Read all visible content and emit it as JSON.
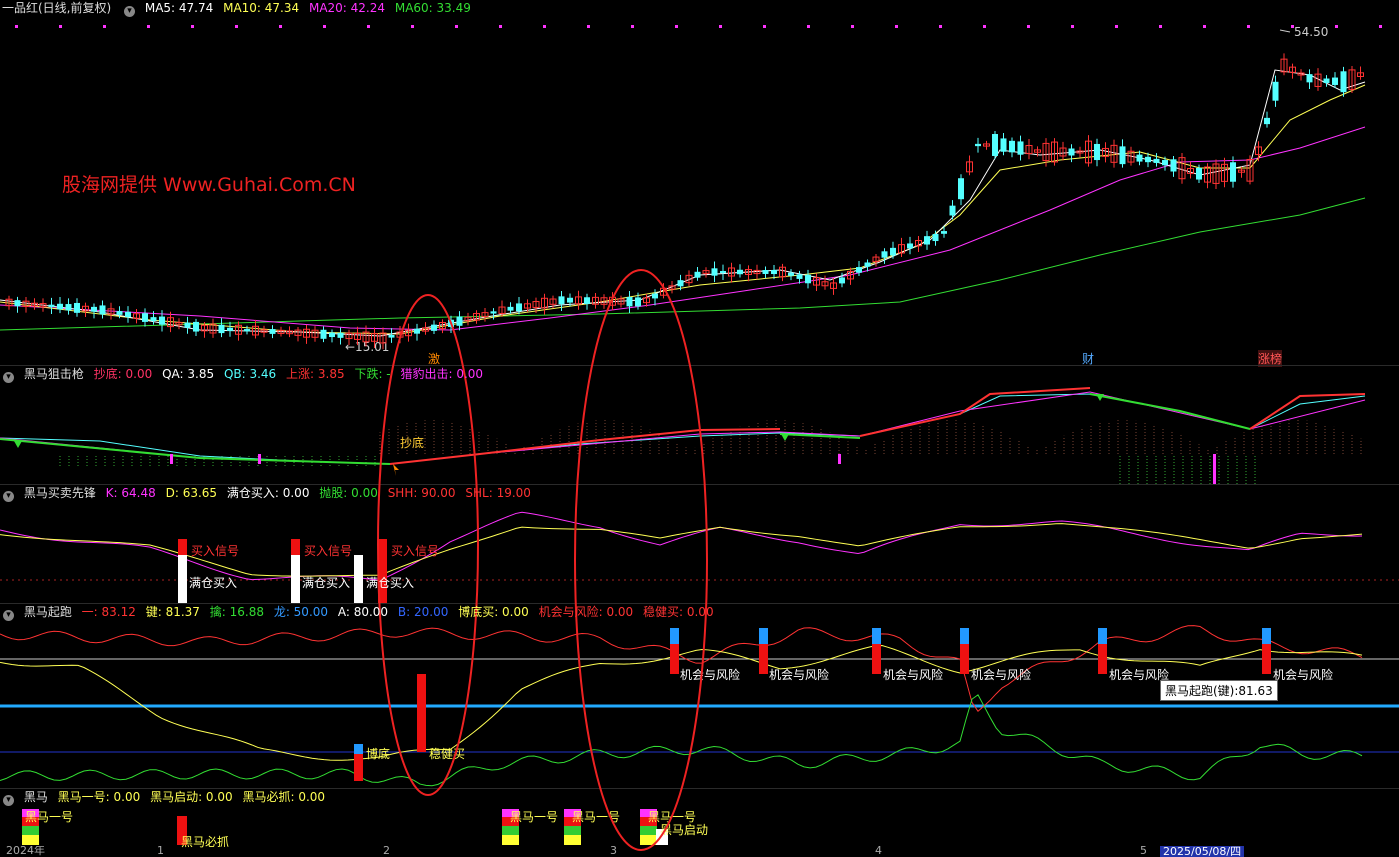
{
  "main": {
    "title": "一品红(日线,前复权)",
    "ma5": "MA5: 47.74",
    "ma10": "MA10: 47.34",
    "ma20": "MA20: 42.24",
    "ma60": "MA60: 33.49",
    "high_label": "54.50",
    "low_label": "←15.01",
    "watermark": "股海网提供 Www.Guhai.Com.CN",
    "markers": [
      "激",
      "财",
      "涨榜"
    ]
  },
  "p1": {
    "name": "黑马狙击枪",
    "f1": "抄底: 0.00",
    "f2": "QA: 3.85",
    "f3": "QB: 3.46",
    "f4": "上涨: 3.85",
    "f5": "下跌: -",
    "f6": "猎豹出击: 0.00",
    "label": "抄底"
  },
  "p2": {
    "name": "黑马买卖先锋",
    "f1": "K: 64.48",
    "f2": "D: 63.65",
    "f3": "满仓买入: 0.00",
    "f4": "抛股: 0.00",
    "f5": "SHH: 90.00",
    "f6": "SHL: 19.00",
    "buy_signal": "买入信号",
    "full_buy": "满仓买入"
  },
  "p3": {
    "name": "黑马起跑",
    "f1": "一: 83.12",
    "f2": "键: 81.37",
    "f3": "擒: 16.88",
    "f4": "龙: 50.00",
    "f5": "A: 80.00",
    "f6": "B: 20.00",
    "f7": "博底买: 0.00",
    "f8": "机会与风险: 0.00",
    "f9": "稳健买: 0.00",
    "chance": "机会与风险",
    "bottom": "博底",
    "steady": "稳健买",
    "tooltip": "黑马起跑(键):81.63"
  },
  "p4": {
    "name": "黑马",
    "f1": "黑马一号: 0.00",
    "f2": "黑马启动: 0.00",
    "f3": "黑马必抓: 0.00",
    "no1": "黑马一号",
    "must": "黑马必抓",
    "start": "黑马启动"
  },
  "axis": {
    "labels": [
      "2024年",
      "1",
      "2",
      "3",
      "4",
      "5"
    ],
    "date": "2025/05/08/四"
  },
  "colors": {
    "up": "#ff3333",
    "down": "#54ffff",
    "ma5": "#ffffff",
    "ma10": "#ffff55",
    "ma20": "#ff33ff",
    "ma60": "#33dd33"
  }
}
